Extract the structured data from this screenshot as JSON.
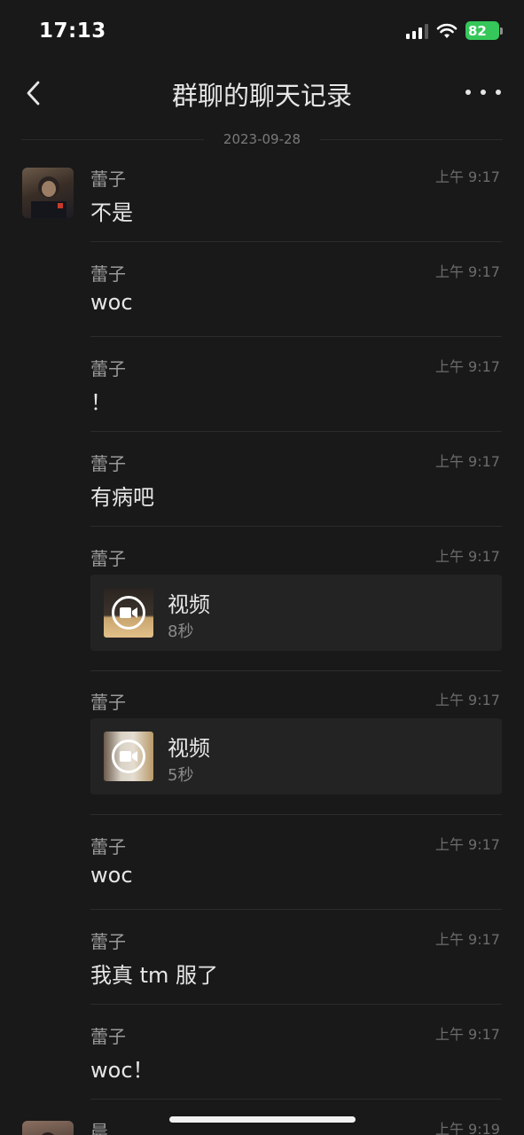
{
  "status_bar": {
    "time": "17:13",
    "battery": "82"
  },
  "header": {
    "title": "群聊的聊天记录"
  },
  "date": "2023-09-28",
  "messages": [
    {
      "sender": "蕾子",
      "time": "上午 9:17",
      "type": "text",
      "text": "不是"
    },
    {
      "sender": "蕾子",
      "time": "上午 9:17",
      "type": "text",
      "text": "woc"
    },
    {
      "sender": "蕾子",
      "time": "上午 9:17",
      "type": "text",
      "text": "！"
    },
    {
      "sender": "蕾子",
      "time": "上午 9:17",
      "type": "text",
      "text": "有病吧"
    },
    {
      "sender": "蕾子",
      "time": "上午 9:17",
      "type": "video",
      "title": "视频",
      "duration": "8秒"
    },
    {
      "sender": "蕾子",
      "time": "上午 9:17",
      "type": "video",
      "title": "视频",
      "duration": "5秒"
    },
    {
      "sender": "蕾子",
      "time": "上午 9:17",
      "type": "text",
      "text": "woc"
    },
    {
      "sender": "蕾子",
      "time": "上午 9:17",
      "type": "text",
      "text": "我真 tm 服了"
    },
    {
      "sender": "蕾子",
      "time": "上午 9:17",
      "type": "text",
      "text": "woc！"
    },
    {
      "sender": "晨",
      "time": "上午 9:19",
      "type": "text",
      "text": ""
    }
  ],
  "icons": {
    "back": "chevron-left-icon",
    "more": "more-dots-icon",
    "signal": "cellular-signal-icon",
    "wifi": "wifi-icon",
    "battery": "battery-icon",
    "video": "video-camera-icon"
  },
  "colors": {
    "background": "#191919",
    "battery_green": "#35c759"
  }
}
